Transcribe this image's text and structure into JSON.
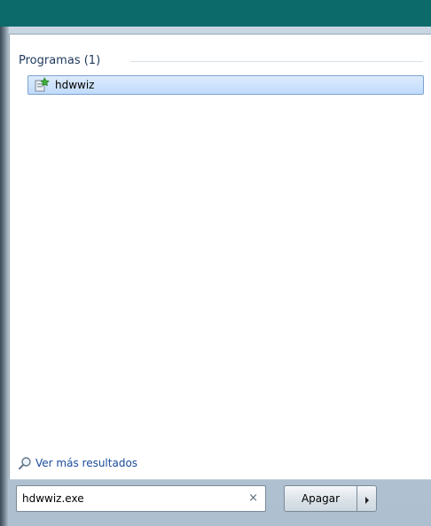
{
  "results": {
    "section_title": "Programas (1)",
    "items": [
      {
        "label": "hdwwiz",
        "icon": "hardware-wizard-icon"
      }
    ]
  },
  "more_results": {
    "label": "Ver más resultados",
    "icon": "search-icon"
  },
  "search": {
    "value": "hdwwiz.exe",
    "clear_icon": "×"
  },
  "shutdown": {
    "label": "Apagar",
    "arrow_icon": "chevron-right-icon"
  },
  "colors": {
    "desktop": "#0c6a6a",
    "selection": "#c1dbfc",
    "link": "#1a4a9c",
    "header_text": "#1e395b"
  }
}
